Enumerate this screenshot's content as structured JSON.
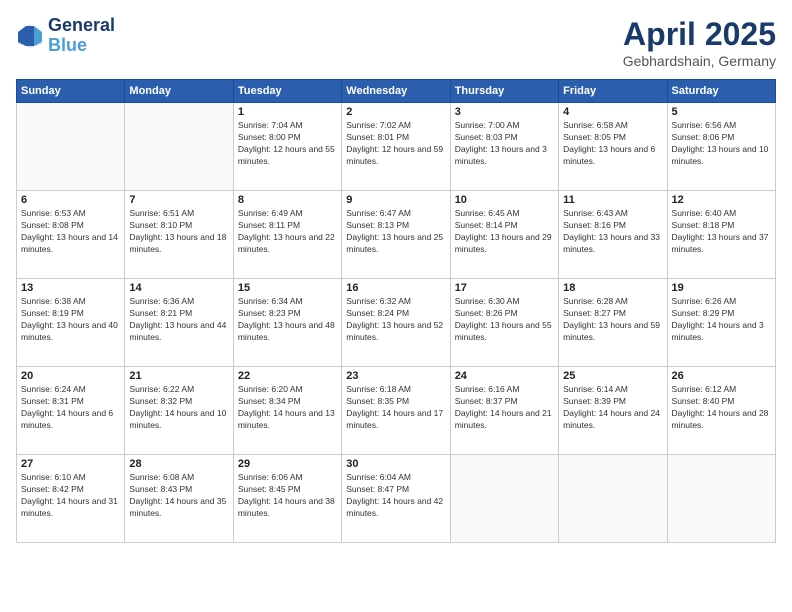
{
  "logo": {
    "line1": "General",
    "line2": "Blue"
  },
  "title": "April 2025",
  "subtitle": "Gebhardshain, Germany",
  "days_of_week": [
    "Sunday",
    "Monday",
    "Tuesday",
    "Wednesday",
    "Thursday",
    "Friday",
    "Saturday"
  ],
  "weeks": [
    [
      {
        "num": "",
        "sunrise": "",
        "sunset": "",
        "daylight": ""
      },
      {
        "num": "",
        "sunrise": "",
        "sunset": "",
        "daylight": ""
      },
      {
        "num": "1",
        "sunrise": "Sunrise: 7:04 AM",
        "sunset": "Sunset: 8:00 PM",
        "daylight": "Daylight: 12 hours and 55 minutes."
      },
      {
        "num": "2",
        "sunrise": "Sunrise: 7:02 AM",
        "sunset": "Sunset: 8:01 PM",
        "daylight": "Daylight: 12 hours and 59 minutes."
      },
      {
        "num": "3",
        "sunrise": "Sunrise: 7:00 AM",
        "sunset": "Sunset: 8:03 PM",
        "daylight": "Daylight: 13 hours and 3 minutes."
      },
      {
        "num": "4",
        "sunrise": "Sunrise: 6:58 AM",
        "sunset": "Sunset: 8:05 PM",
        "daylight": "Daylight: 13 hours and 6 minutes."
      },
      {
        "num": "5",
        "sunrise": "Sunrise: 6:56 AM",
        "sunset": "Sunset: 8:06 PM",
        "daylight": "Daylight: 13 hours and 10 minutes."
      }
    ],
    [
      {
        "num": "6",
        "sunrise": "Sunrise: 6:53 AM",
        "sunset": "Sunset: 8:08 PM",
        "daylight": "Daylight: 13 hours and 14 minutes."
      },
      {
        "num": "7",
        "sunrise": "Sunrise: 6:51 AM",
        "sunset": "Sunset: 8:10 PM",
        "daylight": "Daylight: 13 hours and 18 minutes."
      },
      {
        "num": "8",
        "sunrise": "Sunrise: 6:49 AM",
        "sunset": "Sunset: 8:11 PM",
        "daylight": "Daylight: 13 hours and 22 minutes."
      },
      {
        "num": "9",
        "sunrise": "Sunrise: 6:47 AM",
        "sunset": "Sunset: 8:13 PM",
        "daylight": "Daylight: 13 hours and 25 minutes."
      },
      {
        "num": "10",
        "sunrise": "Sunrise: 6:45 AM",
        "sunset": "Sunset: 8:14 PM",
        "daylight": "Daylight: 13 hours and 29 minutes."
      },
      {
        "num": "11",
        "sunrise": "Sunrise: 6:43 AM",
        "sunset": "Sunset: 8:16 PM",
        "daylight": "Daylight: 13 hours and 33 minutes."
      },
      {
        "num": "12",
        "sunrise": "Sunrise: 6:40 AM",
        "sunset": "Sunset: 8:18 PM",
        "daylight": "Daylight: 13 hours and 37 minutes."
      }
    ],
    [
      {
        "num": "13",
        "sunrise": "Sunrise: 6:38 AM",
        "sunset": "Sunset: 8:19 PM",
        "daylight": "Daylight: 13 hours and 40 minutes."
      },
      {
        "num": "14",
        "sunrise": "Sunrise: 6:36 AM",
        "sunset": "Sunset: 8:21 PM",
        "daylight": "Daylight: 13 hours and 44 minutes."
      },
      {
        "num": "15",
        "sunrise": "Sunrise: 6:34 AM",
        "sunset": "Sunset: 8:23 PM",
        "daylight": "Daylight: 13 hours and 48 minutes."
      },
      {
        "num": "16",
        "sunrise": "Sunrise: 6:32 AM",
        "sunset": "Sunset: 8:24 PM",
        "daylight": "Daylight: 13 hours and 52 minutes."
      },
      {
        "num": "17",
        "sunrise": "Sunrise: 6:30 AM",
        "sunset": "Sunset: 8:26 PM",
        "daylight": "Daylight: 13 hours and 55 minutes."
      },
      {
        "num": "18",
        "sunrise": "Sunrise: 6:28 AM",
        "sunset": "Sunset: 8:27 PM",
        "daylight": "Daylight: 13 hours and 59 minutes."
      },
      {
        "num": "19",
        "sunrise": "Sunrise: 6:26 AM",
        "sunset": "Sunset: 8:29 PM",
        "daylight": "Daylight: 14 hours and 3 minutes."
      }
    ],
    [
      {
        "num": "20",
        "sunrise": "Sunrise: 6:24 AM",
        "sunset": "Sunset: 8:31 PM",
        "daylight": "Daylight: 14 hours and 6 minutes."
      },
      {
        "num": "21",
        "sunrise": "Sunrise: 6:22 AM",
        "sunset": "Sunset: 8:32 PM",
        "daylight": "Daylight: 14 hours and 10 minutes."
      },
      {
        "num": "22",
        "sunrise": "Sunrise: 6:20 AM",
        "sunset": "Sunset: 8:34 PM",
        "daylight": "Daylight: 14 hours and 13 minutes."
      },
      {
        "num": "23",
        "sunrise": "Sunrise: 6:18 AM",
        "sunset": "Sunset: 8:35 PM",
        "daylight": "Daylight: 14 hours and 17 minutes."
      },
      {
        "num": "24",
        "sunrise": "Sunrise: 6:16 AM",
        "sunset": "Sunset: 8:37 PM",
        "daylight": "Daylight: 14 hours and 21 minutes."
      },
      {
        "num": "25",
        "sunrise": "Sunrise: 6:14 AM",
        "sunset": "Sunset: 8:39 PM",
        "daylight": "Daylight: 14 hours and 24 minutes."
      },
      {
        "num": "26",
        "sunrise": "Sunrise: 6:12 AM",
        "sunset": "Sunset: 8:40 PM",
        "daylight": "Daylight: 14 hours and 28 minutes."
      }
    ],
    [
      {
        "num": "27",
        "sunrise": "Sunrise: 6:10 AM",
        "sunset": "Sunset: 8:42 PM",
        "daylight": "Daylight: 14 hours and 31 minutes."
      },
      {
        "num": "28",
        "sunrise": "Sunrise: 6:08 AM",
        "sunset": "Sunset: 8:43 PM",
        "daylight": "Daylight: 14 hours and 35 minutes."
      },
      {
        "num": "29",
        "sunrise": "Sunrise: 6:06 AM",
        "sunset": "Sunset: 8:45 PM",
        "daylight": "Daylight: 14 hours and 38 minutes."
      },
      {
        "num": "30",
        "sunrise": "Sunrise: 6:04 AM",
        "sunset": "Sunset: 8:47 PM",
        "daylight": "Daylight: 14 hours and 42 minutes."
      },
      {
        "num": "",
        "sunrise": "",
        "sunset": "",
        "daylight": ""
      },
      {
        "num": "",
        "sunrise": "",
        "sunset": "",
        "daylight": ""
      },
      {
        "num": "",
        "sunrise": "",
        "sunset": "",
        "daylight": ""
      }
    ]
  ]
}
